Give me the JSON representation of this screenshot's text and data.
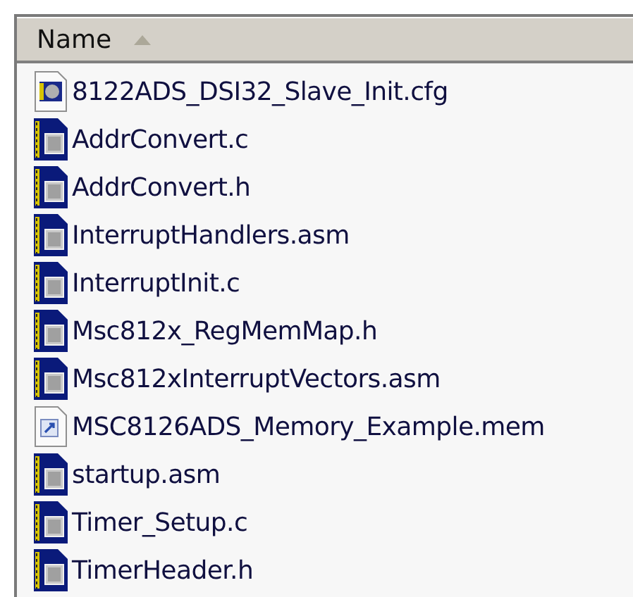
{
  "column": {
    "label": "Name",
    "sorted_ascending": true
  },
  "files": [
    {
      "name": "8122ADS_DSI32_Slave_Init.cfg",
      "kind": "config"
    },
    {
      "name": "AddrConvert.c",
      "kind": "source"
    },
    {
      "name": "AddrConvert.h",
      "kind": "source"
    },
    {
      "name": "InterruptHandlers.asm",
      "kind": "source"
    },
    {
      "name": "InterruptInit.c",
      "kind": "source"
    },
    {
      "name": "Msc812x_RegMemMap.h",
      "kind": "source"
    },
    {
      "name": "Msc812xInterruptVectors.asm",
      "kind": "source"
    },
    {
      "name": "MSC8126ADS_Memory_Example.mem",
      "kind": "shortcut"
    },
    {
      "name": "startup.asm",
      "kind": "source"
    },
    {
      "name": "Timer_Setup.c",
      "kind": "source"
    },
    {
      "name": "TimerHeader.h",
      "kind": "source"
    }
  ]
}
